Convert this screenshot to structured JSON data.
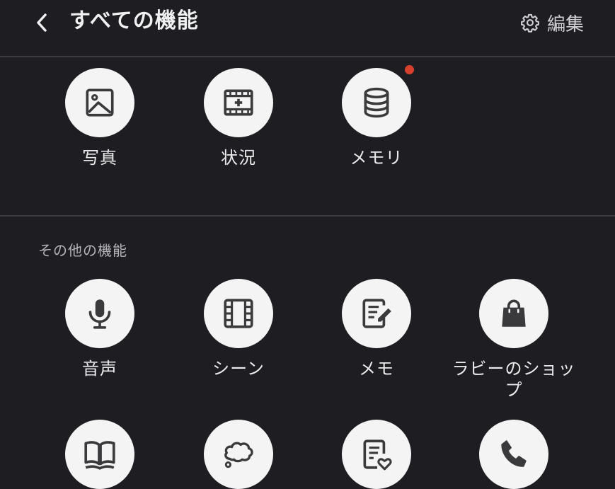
{
  "header": {
    "back_icon": "chevron-left-icon",
    "title": "すべての機能",
    "edit_icon": "gear-icon",
    "edit_label": "編集"
  },
  "pinned": [
    {
      "label": "写真",
      "icon": "image-icon",
      "badge": false
    },
    {
      "label": "状況",
      "icon": "film-plus-icon",
      "badge": false
    },
    {
      "label": "メモリ",
      "icon": "database-icon",
      "badge": true
    }
  ],
  "other_section": {
    "title": "その他の機能",
    "items": [
      {
        "label": "音声",
        "icon": "microphone-icon"
      },
      {
        "label": "シーン",
        "icon": "film-strip-icon"
      },
      {
        "label": "メモ",
        "icon": "note-edit-icon"
      },
      {
        "label": "ラビーのショップ",
        "icon": "shopping-bag-icon"
      },
      {
        "label": "",
        "icon": "book-icon"
      },
      {
        "label": "",
        "icon": "thought-bubble-icon"
      },
      {
        "label": "",
        "icon": "note-heart-icon"
      },
      {
        "label": "",
        "icon": "phone-icon"
      }
    ]
  },
  "colors": {
    "background": "#1e1d22",
    "divider": "#3a3a40",
    "icon_circle": "#f4f4f4",
    "icon_glyph": "#3a3a3c",
    "badge": "#d8402e"
  }
}
